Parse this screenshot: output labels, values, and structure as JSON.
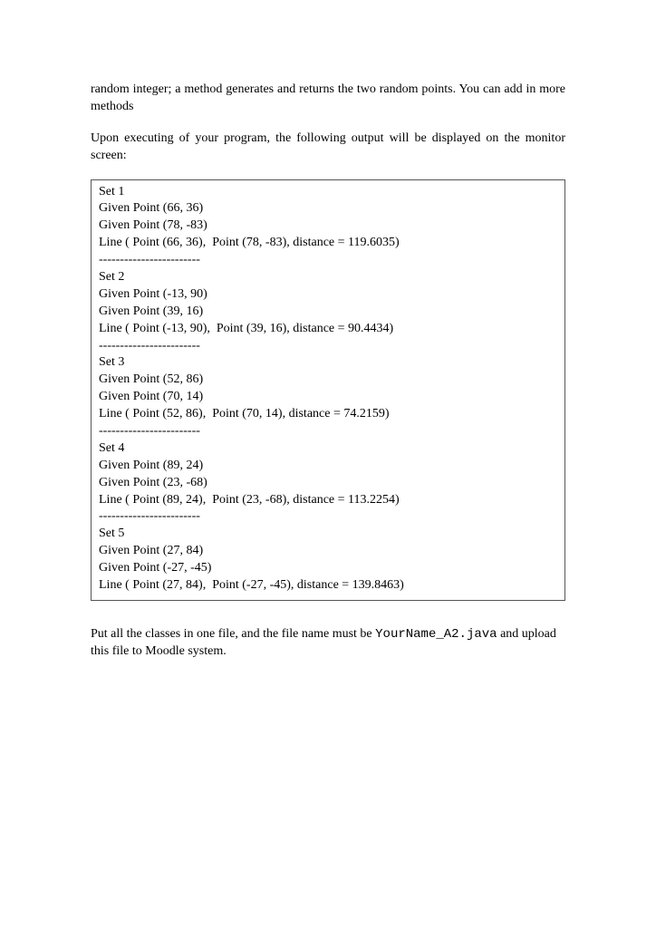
{
  "paragraphs": {
    "intro": "random integer; a method generates and returns the two random points. You can add in more methods",
    "exec": "Upon executing of your program, the following output will be displayed on the monitor screen:",
    "upload_before": "Put all the classes in one file, and the file name must be ",
    "filename": "YourName_A2.java",
    "upload_after": " and upload this file to Moodle system."
  },
  "output_text": "Set 1\nGiven Point (66, 36)\nGiven Point (78, -83)\nLine ( Point (66, 36),  Point (78, -83), distance = 119.6035)\n------------------------\nSet 2\nGiven Point (-13, 90)\nGiven Point (39, 16)\nLine ( Point (-13, 90),  Point (39, 16), distance = 90.4434)\n------------------------\nSet 3\nGiven Point (52, 86)\nGiven Point (70, 14)\nLine ( Point (52, 86),  Point (70, 14), distance = 74.2159)\n------------------------\nSet 4\nGiven Point (89, 24)\nGiven Point (23, -68)\nLine ( Point (89, 24),  Point (23, -68), distance = 113.2254)\n------------------------\nSet 5\nGiven Point (27, 84)\nGiven Point (-27, -45)\nLine ( Point (27, 84),  Point (-27, -45), distance = 139.8463)"
}
